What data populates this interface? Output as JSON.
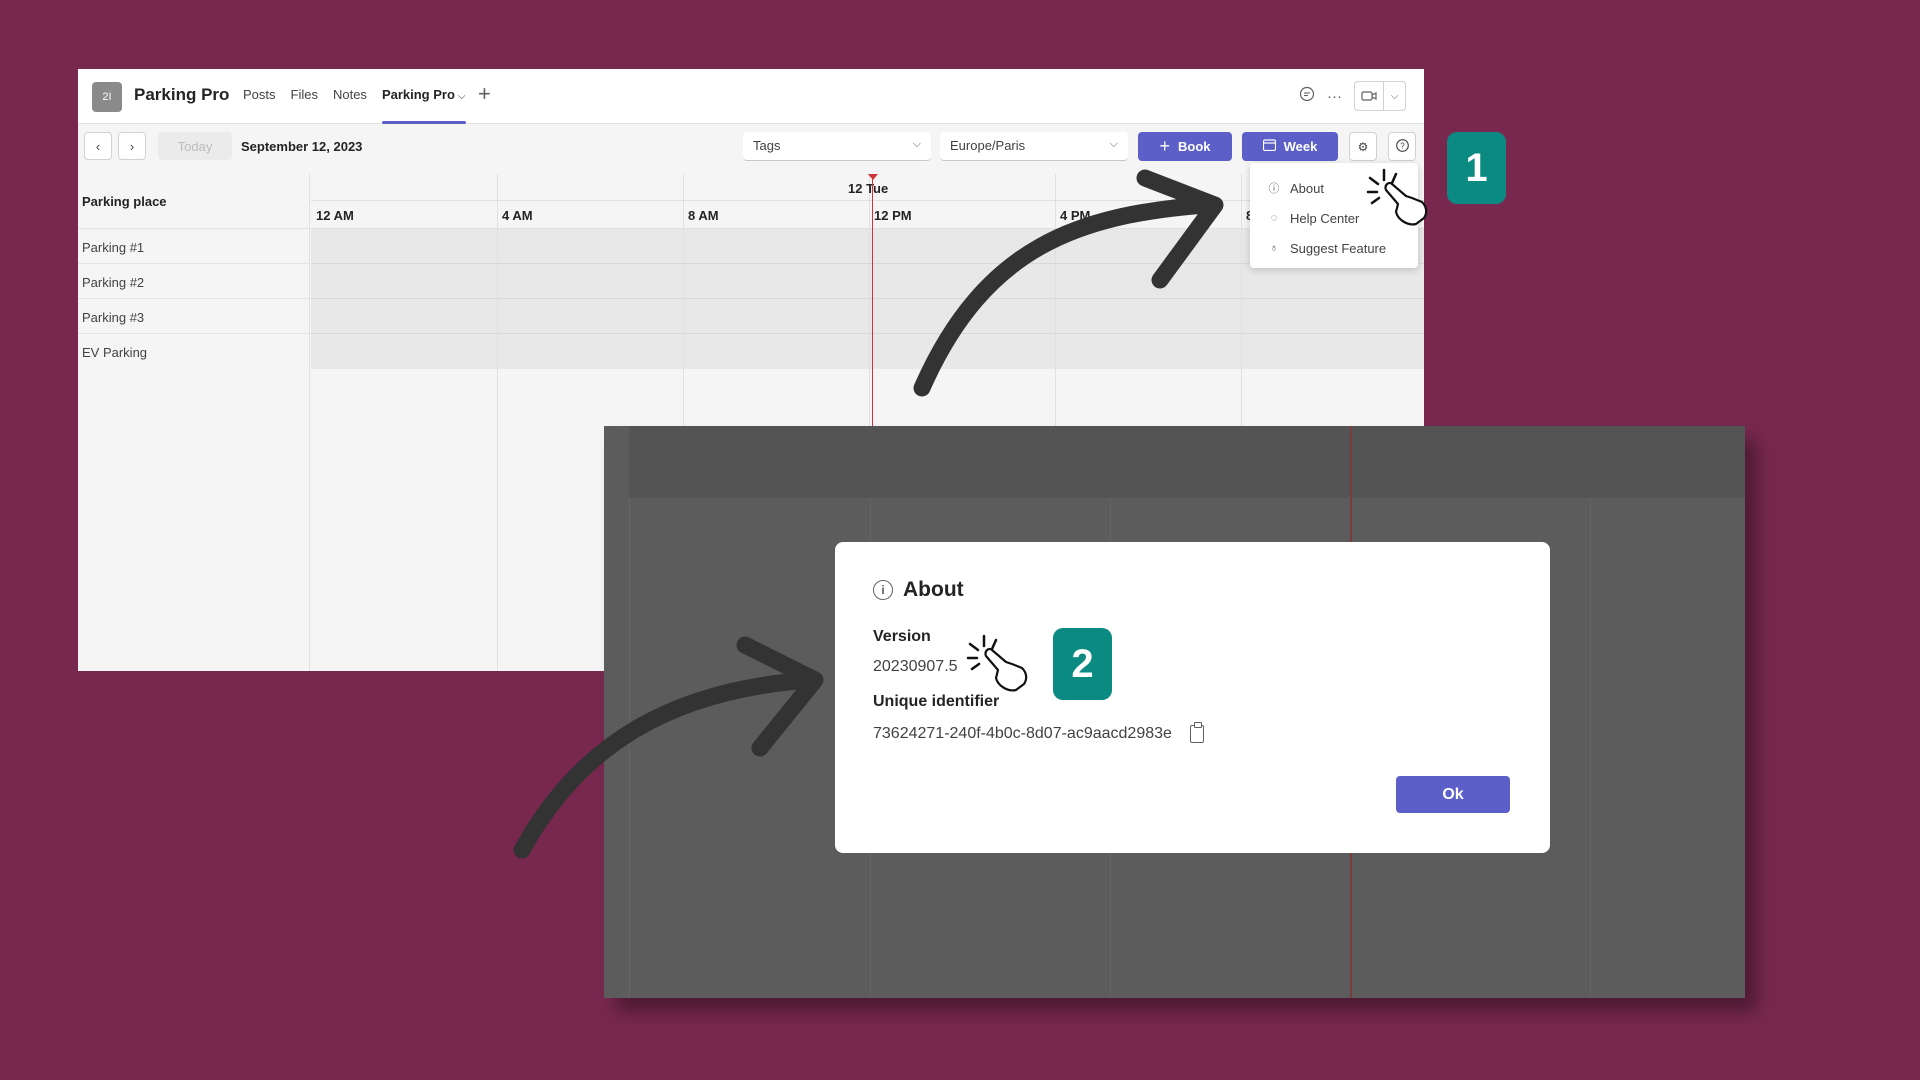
{
  "app": {
    "logo_text": "2I",
    "title": "Parking Pro",
    "tabs": [
      {
        "label": "Posts"
      },
      {
        "label": "Files"
      },
      {
        "label": "Notes"
      },
      {
        "label": "Parking Pro",
        "active": true
      }
    ],
    "add_tab": "+",
    "header_icons": [
      "chat-icon",
      "more-icon",
      "video-icon",
      "chevron-down-icon"
    ]
  },
  "toolbar": {
    "prev": "‹",
    "next": "›",
    "today": "Today",
    "date": "September 12, 2023",
    "tags_placeholder": "Tags",
    "timezone": "Europe/Paris",
    "book_label": "Book",
    "week_label": "Week",
    "accent_color": "#5b5fc7"
  },
  "calendar": {
    "resource_header": "Parking place",
    "resources": [
      "Parking #1",
      "Parking #2",
      "Parking #3",
      "EV Parking"
    ],
    "day_label": "12 Tue",
    "hours": [
      "12 AM",
      "4 AM",
      "8 AM",
      "12 PM",
      "4 PM",
      "8"
    ],
    "now_color": "#d13438"
  },
  "help_menu": {
    "items": [
      {
        "label": "About",
        "icon": "info-icon"
      },
      {
        "label": "Help Center",
        "icon": "chat-help-icon"
      },
      {
        "label": "Suggest Feature",
        "icon": "lightbulb-icon"
      }
    ]
  },
  "about_dialog": {
    "title": "About",
    "version_label": "Version",
    "version": "20230907.5",
    "id_label": "Unique identifier",
    "id": "73624271-240f-4b0c-8d07-ac9aacd2983e",
    "ok_label": "Ok"
  },
  "badges": {
    "step1": "1",
    "step2": "2",
    "color": "#0b8a82"
  },
  "background_color": "#78284f"
}
